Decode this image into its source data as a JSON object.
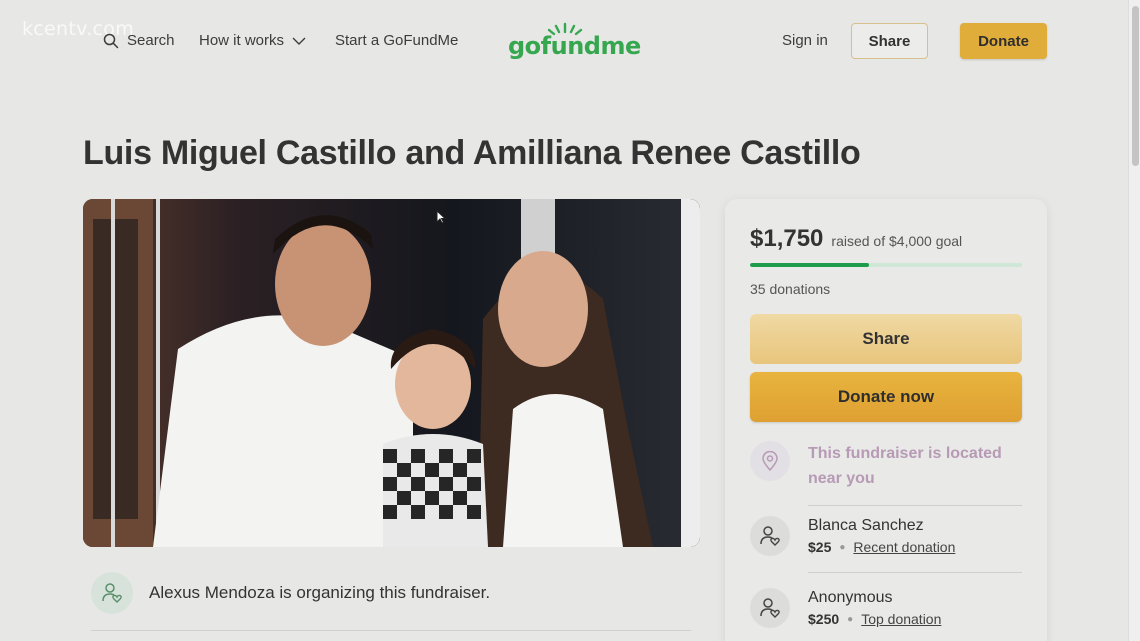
{
  "watermark": "kcentv.com",
  "nav": {
    "search_label": "Search",
    "how_label": "How it works",
    "start_label": "Start a GoFundMe",
    "logo_text": "gofundme",
    "signin_label": "Sign in",
    "share_label": "Share",
    "donate_label": "Donate"
  },
  "campaign": {
    "title": "Luis Miguel Castillo and Amilliana Renee Castillo",
    "organizer_text": "Alexus Mendoza is organizing this fundraiser."
  },
  "donation_card": {
    "amount": "$1,750",
    "goal_text": "raised of $4,000 goal",
    "progress_fraction": 0.4375,
    "donations_count": "35 donations",
    "share_label": "Share",
    "donate_label": "Donate now",
    "location_text": "This fundraiser is located near you",
    "donors": [
      {
        "name": "Blanca Sanchez",
        "amount": "$25",
        "tag": "Recent donation"
      },
      {
        "name": "Anonymous",
        "amount": "$250",
        "tag": "Top donation"
      }
    ]
  },
  "colors": {
    "brand_green": "#36a74f",
    "donate_gold": "#e0ad3a",
    "progress_green": "#1e9b4b",
    "location_purple": "#b79ab5"
  },
  "icons": [
    "search-icon",
    "chevron-down-icon",
    "location-pin-icon",
    "user-heart-icon",
    "cursor-icon"
  ]
}
